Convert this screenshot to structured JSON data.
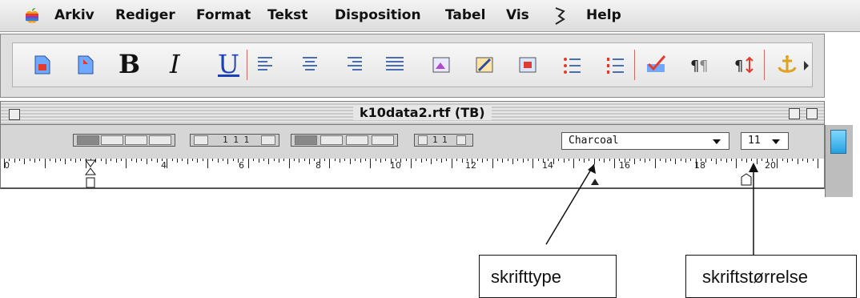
{
  "menubar": {
    "items": [
      "Arkiv",
      "Rediger",
      "Format",
      "Tekst",
      "Disposition",
      "Tabel",
      "Vis",
      "Help"
    ],
    "apple_icon": "apple-menu-icon",
    "script_icon": "script-menu-icon"
  },
  "toolbar": {
    "bold_label": "B",
    "italic_label": "I",
    "underline_label": "U",
    "icons": [
      "new-document-icon",
      "open-document-icon",
      "bold-icon",
      "italic-icon",
      "underline-icon",
      "align-left-icon",
      "align-center-icon",
      "align-right-icon",
      "justify-icon",
      "insert-image-icon",
      "edit-image-icon",
      "insert-object-icon",
      "bullet-list-icon",
      "numbered-list-icon",
      "spellcheck-icon",
      "show-invisibles-icon",
      "paragraph-spacing-icon",
      "anchor-icon"
    ]
  },
  "window": {
    "title": "k10data2.rtf (TB)",
    "font_value": "Charcoal",
    "size_value": "11",
    "spacing_value": "1",
    "line_value": "1",
    "ruler_numbers": [
      "0",
      "4",
      "6",
      "8",
      "10",
      "12",
      "14",
      "16",
      "18",
      "20"
    ],
    "ruler_max": 20
  },
  "callouts": {
    "font_label": "skrifttype",
    "size_label": "skriftstørrelse"
  },
  "colors": {
    "accent_thumb": "#26a0e0",
    "separator": "#c86a6a"
  }
}
